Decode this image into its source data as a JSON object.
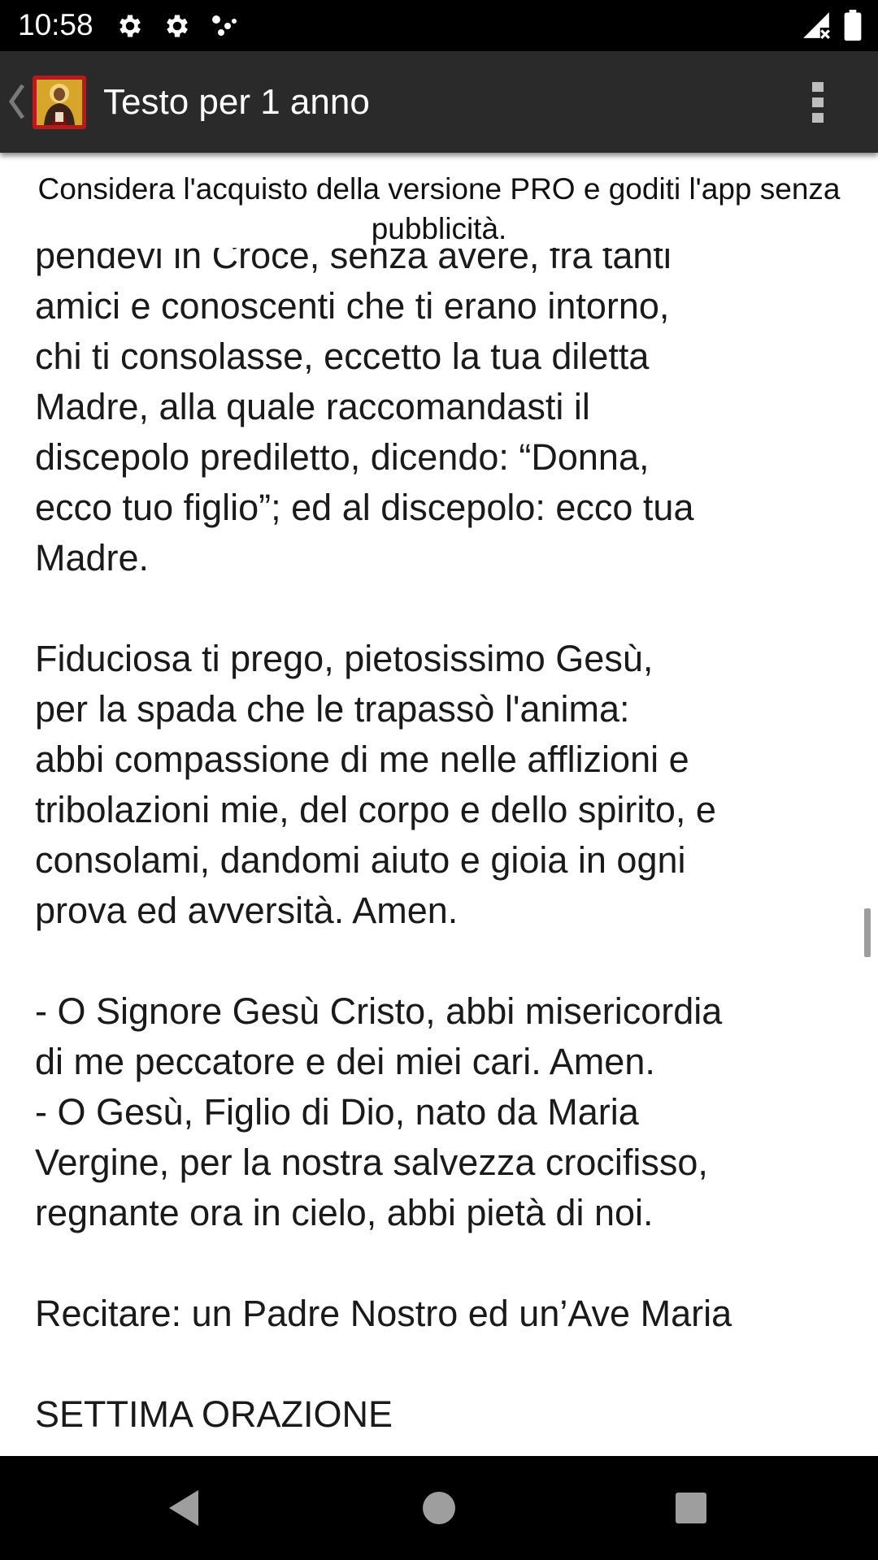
{
  "status_bar": {
    "time": "10:58",
    "icons": [
      "settings-icon",
      "settings-icon",
      "dots-icon"
    ],
    "right_icons": [
      "signal-icon",
      "battery-icon"
    ]
  },
  "app_bar": {
    "title": "Testo per 1 anno",
    "back_icon": "chevron-left-icon",
    "app_icon": "saint-icon",
    "menu_icon": "more-vert-icon"
  },
  "ad_notice": "Considera l'acquisto della versione PRO e goditi l'app senza pubblicità.",
  "content": {
    "text": "pendevi in Croce, senza avere, fra tanti\namici e conoscenti che ti erano intorno,\nchi ti consolasse, eccetto la tua diletta\nMadre, alla quale raccomandasti il\ndiscepolo prediletto, dicendo: “Donna,\necco tuo figlio”; ed al discepolo: ecco tua\nMadre.\n\nFiduciosa ti prego, pietosissimo Gesù,\nper la spada che le trapassò l'anima:\nabbi compassione di me nelle afflizioni e\ntribolazioni mie, del corpo e dello spirito, e\nconsolami, dandomi aiuto e gioia in ogni\nprova ed avversità. Amen.\n\n- O Signore Gesù Cristo, abbi misericordia\ndi me peccatore e dei miei cari. Amen.\n- O Gesù, Figlio di Dio, nato da Maria\nVergine, per la nostra salvezza crocifisso,\nregnante ora in cielo, abbi pietà di noi.\n\nRecitare: un Padre Nostro ed un’Ave Maria\n\nSETTIMA ORAZIONE"
  },
  "nav_bar": {
    "back": "nav-back-icon",
    "home": "nav-home-icon",
    "recents": "nav-recents-icon"
  },
  "colors": {
    "status_bar": "#000000",
    "app_bar": "#2a2a2a",
    "background": "#ffffff",
    "text": "#1a1a1a",
    "icon_red": "#b8191b",
    "icon_gold": "#e2b531"
  }
}
